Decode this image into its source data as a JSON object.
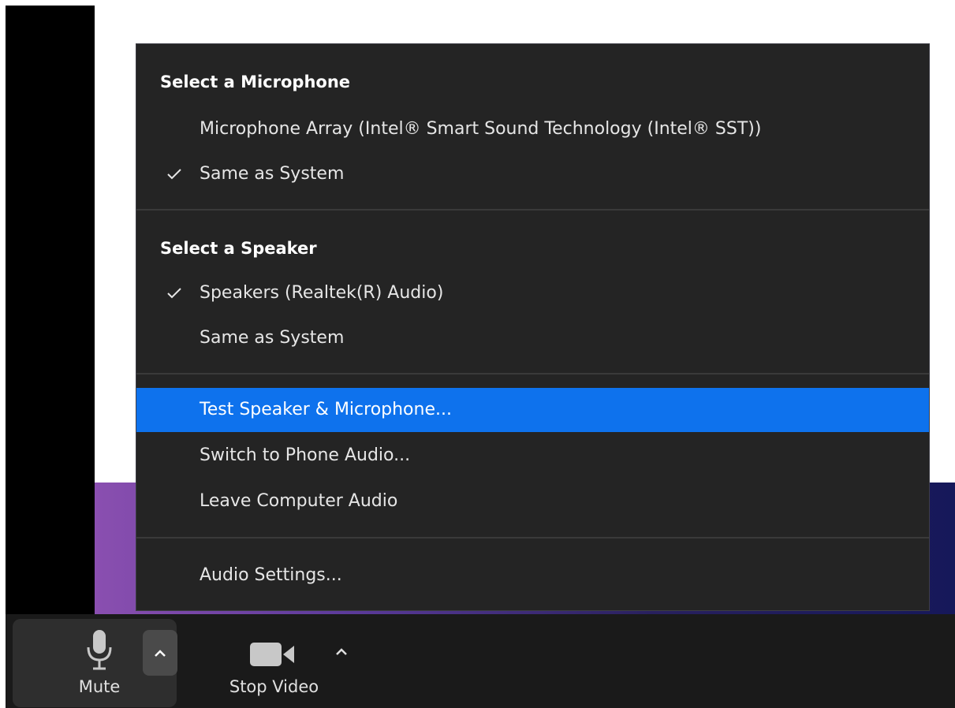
{
  "menu": {
    "microphone_header": "Select a Microphone",
    "microphones": [
      {
        "label": "Microphone Array (Intel® Smart Sound Technology (Intel® SST))",
        "checked": false
      },
      {
        "label": "Same as System",
        "checked": true
      }
    ],
    "speaker_header": "Select a Speaker",
    "speakers": [
      {
        "label": "Speakers (Realtek(R) Audio)",
        "checked": true
      },
      {
        "label": "Same as System",
        "checked": false
      }
    ],
    "actions": [
      {
        "label": "Test Speaker & Microphone...",
        "highlighted": true
      },
      {
        "label": "Switch to Phone Audio..."
      },
      {
        "label": "Leave Computer Audio"
      }
    ],
    "settings_label": "Audio Settings...",
    "check_glyph": "check-icon",
    "highlight_color": "#0e72ed"
  },
  "toolbar": {
    "mute_label": "Mute",
    "stop_video_label": "Stop Video",
    "mic_icon": "microphone-icon",
    "camera_icon": "video-camera-icon",
    "chevron_icon": "chevron-up-icon"
  }
}
